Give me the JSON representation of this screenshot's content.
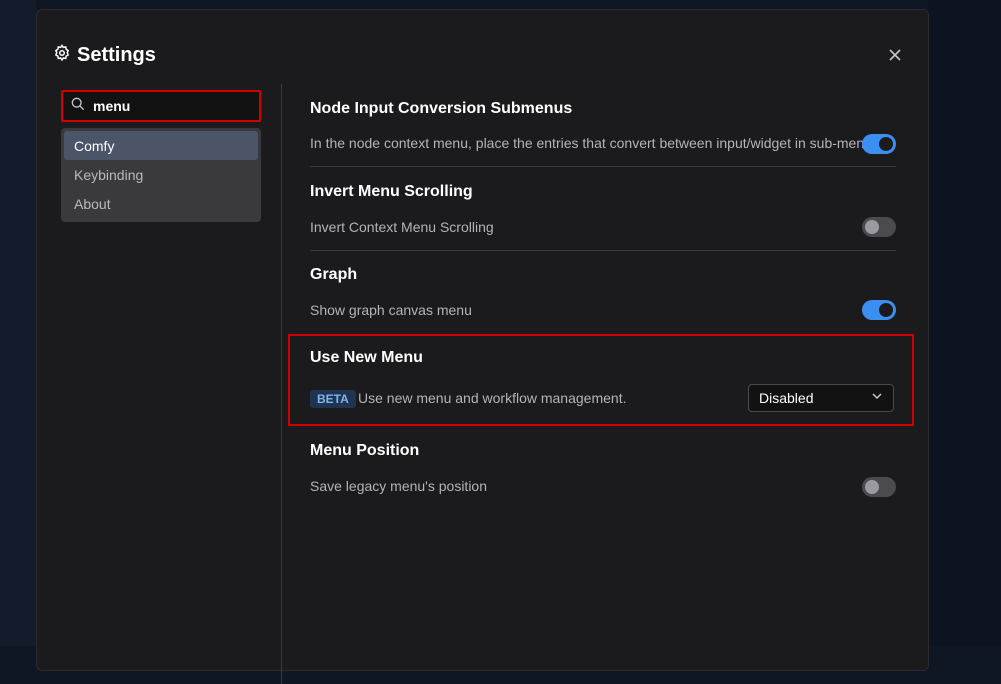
{
  "dialog": {
    "title": "Settings",
    "icon": "gear-icon",
    "close_icon": "close-icon"
  },
  "search": {
    "value": "menu",
    "icon": "search-icon"
  },
  "categories": [
    {
      "label": "Comfy",
      "active": true
    },
    {
      "label": "Keybinding",
      "active": false
    },
    {
      "label": "About",
      "active": false
    }
  ],
  "settings": [
    {
      "title": "Node Input Conversion Submenus",
      "description": "In the node context menu, place the entries that convert between input/widget in sub-menus.",
      "control": "toggle",
      "enabled": true
    },
    {
      "title": "Invert Menu Scrolling",
      "description": "Invert Context Menu Scrolling",
      "control": "toggle",
      "enabled": false
    },
    {
      "title": "Graph",
      "description": "Show graph canvas menu",
      "control": "toggle",
      "enabled": true
    },
    {
      "title": "Use New Menu",
      "badge": "BETA",
      "description": "Use new menu and workflow management.",
      "control": "dropdown",
      "value": "Disabled"
    },
    {
      "title": "Menu Position",
      "description": "Save legacy menu's position",
      "control": "toggle",
      "enabled": false
    }
  ],
  "colors": {
    "accent": "#3b8ff0",
    "highlight": "#d40000",
    "dialog_bg": "#1b1b1d"
  }
}
